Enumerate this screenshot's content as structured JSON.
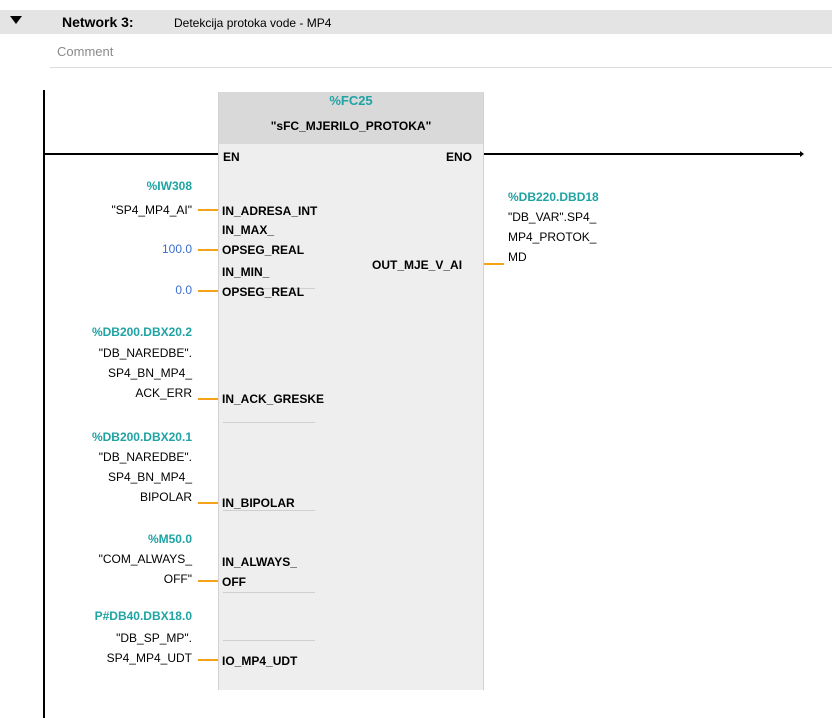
{
  "network": {
    "number_label": "Network 3:",
    "title": "Detekcija protoka vode - MP4",
    "comment_placeholder": "Comment"
  },
  "block": {
    "address": "%FC25",
    "name": "\"sFC_MJERILO_PROTOKA\""
  },
  "pins": {
    "en": "EN",
    "eno": "ENO",
    "in_adresa_int": "IN_ADRESA_INT",
    "in_max_1": "IN_MAX_",
    "in_max_2": "OPSEG_REAL",
    "in_min_1": "IN_MIN_",
    "in_min_2": "OPSEG_REAL",
    "out_mje": "OUT_MJE_V_AI",
    "in_ack": "IN_ACK_GRESKE",
    "in_bipolar": "IN_BIPOLAR",
    "in_always_1": "IN_ALWAYS_",
    "in_always_2": "OFF",
    "io_mp4": "IO_MP4_UDT"
  },
  "operands": {
    "iw308_addr": "%IW308",
    "iw308_name": "\"SP4_MP4_AI\"",
    "max_value": "100.0",
    "min_value": "0.0",
    "out_addr": "%DB220.DBD18",
    "out_l1": "\"DB_VAR\".SP4_",
    "out_l2": "MP4_PROTOK_",
    "out_l3": "MD",
    "ack_addr": "%DB200.DBX20.2",
    "ack_l1": "\"DB_NAREDBE\".",
    "ack_l2": "SP4_BN_MP4_",
    "ack_l3": "ACK_ERR",
    "bip_addr": "%DB200.DBX20.1",
    "bip_l1": "\"DB_NAREDBE\".",
    "bip_l2": "SP4_BN_MP4_",
    "bip_l3": "BIPOLAR",
    "m50_addr": "%M50.0",
    "m50_l1": "\"COM_ALWAYS_",
    "m50_l2": "OFF\"",
    "udt_addr": "P#DB40.DBX18.0",
    "udt_l1": "\"DB_SP_MP\".",
    "udt_l2": "SP4_MP4_UDT"
  }
}
